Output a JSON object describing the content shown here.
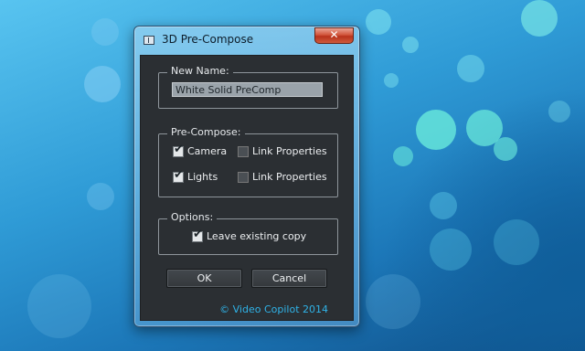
{
  "window": {
    "title": "3D Pre-Compose",
    "close_glyph": "✕",
    "title_icon": "window-icon"
  },
  "new_name": {
    "legend": "New Name:",
    "value": "White Solid PreComp"
  },
  "precompose": {
    "legend": "Pre-Compose:",
    "camera_label": "Camera",
    "camera_checked": true,
    "camera_link_label": "Link Properties",
    "camera_link_checked": false,
    "lights_label": "Lights",
    "lights_checked": true,
    "lights_link_label": "Link Properties",
    "lights_link_checked": false
  },
  "options": {
    "legend": "Options:",
    "leave_copy_label": "Leave existing copy",
    "leave_copy_checked": true
  },
  "buttons": {
    "ok_label": "OK",
    "cancel_label": "Cancel"
  },
  "credit": "© Video Copilot 2014",
  "colors": {
    "accent_credit": "#2fb3e8",
    "panel_bg": "#2b2f33",
    "close_button": "#c8452b"
  },
  "check_glyph": "✔"
}
